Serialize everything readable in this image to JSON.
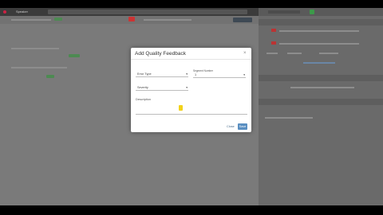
{
  "browser": {
    "tab_title": "Speaker"
  },
  "dialog": {
    "title": "Add Quality Feedback",
    "close": "×",
    "error_type_placeholder": "Error Type",
    "segment_label": "Segment Number",
    "segment_value": "1",
    "severity_placeholder": "Severity",
    "description_placeholder": "Description",
    "cancel_label": "Close",
    "save_label": "Save"
  },
  "colors": {
    "save_button": "#5a8fc1",
    "badge_green": "#4d8a52",
    "cursor_highlight": "#f2d21b"
  },
  "icons": {
    "caret": "▾",
    "collapse": "⌃"
  }
}
